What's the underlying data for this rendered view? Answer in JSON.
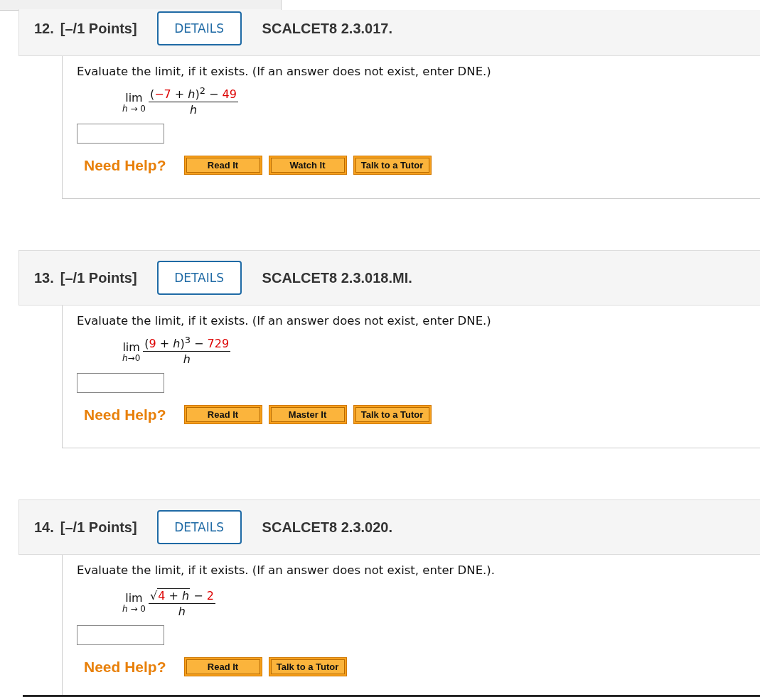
{
  "questions": [
    {
      "number": "12.",
      "points": "[–/1 Points]",
      "details_button": "DETAILS",
      "code": "SCALCET8 2.3.017.",
      "prompt": "Evaluate the limit, if it exists. (If an answer does not exist, enter DNE.)",
      "limit": {
        "label": "lim",
        "under": "*h* → 0",
        "numerator": [
          {
            "kind": "text",
            "text": "("
          },
          {
            "kind": "given",
            "text": "−7"
          },
          {
            "kind": "text",
            "text": " + "
          },
          {
            "kind": "var",
            "text": "h"
          },
          {
            "kind": "text",
            "text": ")"
          },
          {
            "kind": "power",
            "text": "2"
          },
          {
            "kind": "text",
            "text": " − "
          },
          {
            "kind": "given",
            "text": "49"
          }
        ],
        "denominator": "h"
      },
      "need_help": "Need Help?",
      "help_buttons": [
        "Read It",
        "Watch It",
        "Talk to a Tutor"
      ]
    },
    {
      "number": "13.",
      "points": "[–/1 Points]",
      "details_button": "DETAILS",
      "code": "SCALCET8 2.3.018.MI.",
      "prompt": "Evaluate the limit, if it exists. (If an answer does not exist, enter DNE.)",
      "limit": {
        "label": "lim",
        "under": "*h*→0",
        "numerator": [
          {
            "kind": "text",
            "text": "("
          },
          {
            "kind": "given",
            "text": "9"
          },
          {
            "kind": "text",
            "text": " + "
          },
          {
            "kind": "var",
            "text": "h"
          },
          {
            "kind": "text",
            "text": ")"
          },
          {
            "kind": "power",
            "text": "3"
          },
          {
            "kind": "text",
            "text": " − "
          },
          {
            "kind": "given",
            "text": "729"
          }
        ],
        "denominator": "h"
      },
      "need_help": "Need Help?",
      "help_buttons": [
        "Read It",
        "Master It",
        "Talk to a Tutor"
      ]
    },
    {
      "number": "14.",
      "points": "[–/1 Points]",
      "details_button": "DETAILS",
      "code": "SCALCET8 2.3.020.",
      "prompt": "Evaluate the limit, if it exists. (If an answer does not exist, enter DNE.).",
      "limit": {
        "label": "lim",
        "under": "*h* → 0",
        "numerator": [
          {
            "kind": "root",
            "sign": "√",
            "children": [
              {
                "kind": "given",
                "text": "4"
              },
              {
                "kind": "text",
                "text": " + "
              },
              {
                "kind": "var",
                "text": "h"
              }
            ]
          },
          {
            "kind": "text",
            "text": " − "
          },
          {
            "kind": "given",
            "text": "2"
          }
        ],
        "denominator": "h"
      },
      "need_help": "Need Help?",
      "help_buttons": [
        "Read It",
        "Talk to a Tutor"
      ]
    }
  ]
}
